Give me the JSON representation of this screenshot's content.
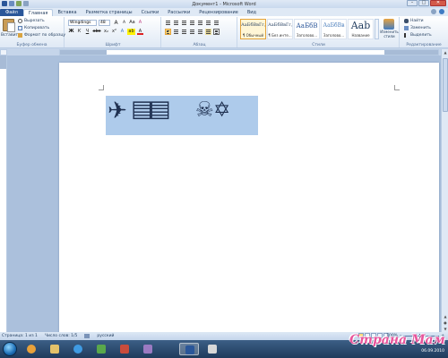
{
  "window": {
    "title": "Документ1 - Microsoft Word"
  },
  "tabs": [
    {
      "label": "Файл"
    },
    {
      "label": "Главная"
    },
    {
      "label": "Вставка"
    },
    {
      "label": "Разметка страницы"
    },
    {
      "label": "Ссылки"
    },
    {
      "label": "Рассылки"
    },
    {
      "label": "Рецензирование"
    },
    {
      "label": "Вид"
    }
  ],
  "clipboard": {
    "paste_label": "Вставить",
    "cut_label": "Вырезать",
    "copy_label": "Копировать",
    "format_painter_label": "Формат по образцу",
    "group_label": "Буфер обмена"
  },
  "font": {
    "font_name": "Wingdings",
    "font_size": "48",
    "grow_label": "A",
    "shrink_label": "A",
    "case_label": "Aa",
    "clear_label": "A",
    "bold_label": "Ж",
    "italic_label": "К",
    "underline_label": "Ч",
    "strike_label": "abc",
    "sub_label": "x₂",
    "sup_label": "x²",
    "effects_label": "A",
    "highlight_label": "ab",
    "color_label": "A",
    "group_label": "Шрифт"
  },
  "paragraph": {
    "group_label": "Абзац"
  },
  "styles": {
    "tiles": [
      {
        "sample": "АаБбВвГг,",
        "name": "¶ Обычный"
      },
      {
        "sample": "АаБбВвГг,",
        "name": "¶ Без инте..."
      },
      {
        "sample": "АаБбВ",
        "name": "Заголово..."
      },
      {
        "sample": "АаБбВв",
        "name": "Заголово..."
      },
      {
        "sample": "Aab",
        "name": "Название"
      }
    ],
    "change_styles_label": "Изменить стили",
    "group_label": "Стили"
  },
  "editing": {
    "find_label": "Найти",
    "replace_label": "Заменить",
    "select_label": "Выделить",
    "group_label": "Редактирование"
  },
  "document": {
    "glyphs": [
      "✈",
      "▤",
      "▤",
      "☠",
      "✡"
    ]
  },
  "status": {
    "page": "Страница: 1 из 1",
    "words": "Число слов: 1/5",
    "language": "русский",
    "zoom": "100%"
  },
  "taskbar": {
    "date": "06.09.2010"
  },
  "watermark": {
    "text": "Страна Мам"
  },
  "colors": {
    "file_tab": "#2a5699",
    "selection": "#aecbeb",
    "ribbon_bg": "#dfe9f5",
    "taskbar": "#1f3b5c"
  },
  "icons": {
    "paste": "clipboard-icon",
    "cut": "scissors-icon",
    "copy": "copy-icon",
    "format_painter": "brush-icon",
    "find": "binoculars-icon",
    "replace": "replace-icon",
    "select": "cursor-icon",
    "change_styles": "styles-icon"
  }
}
